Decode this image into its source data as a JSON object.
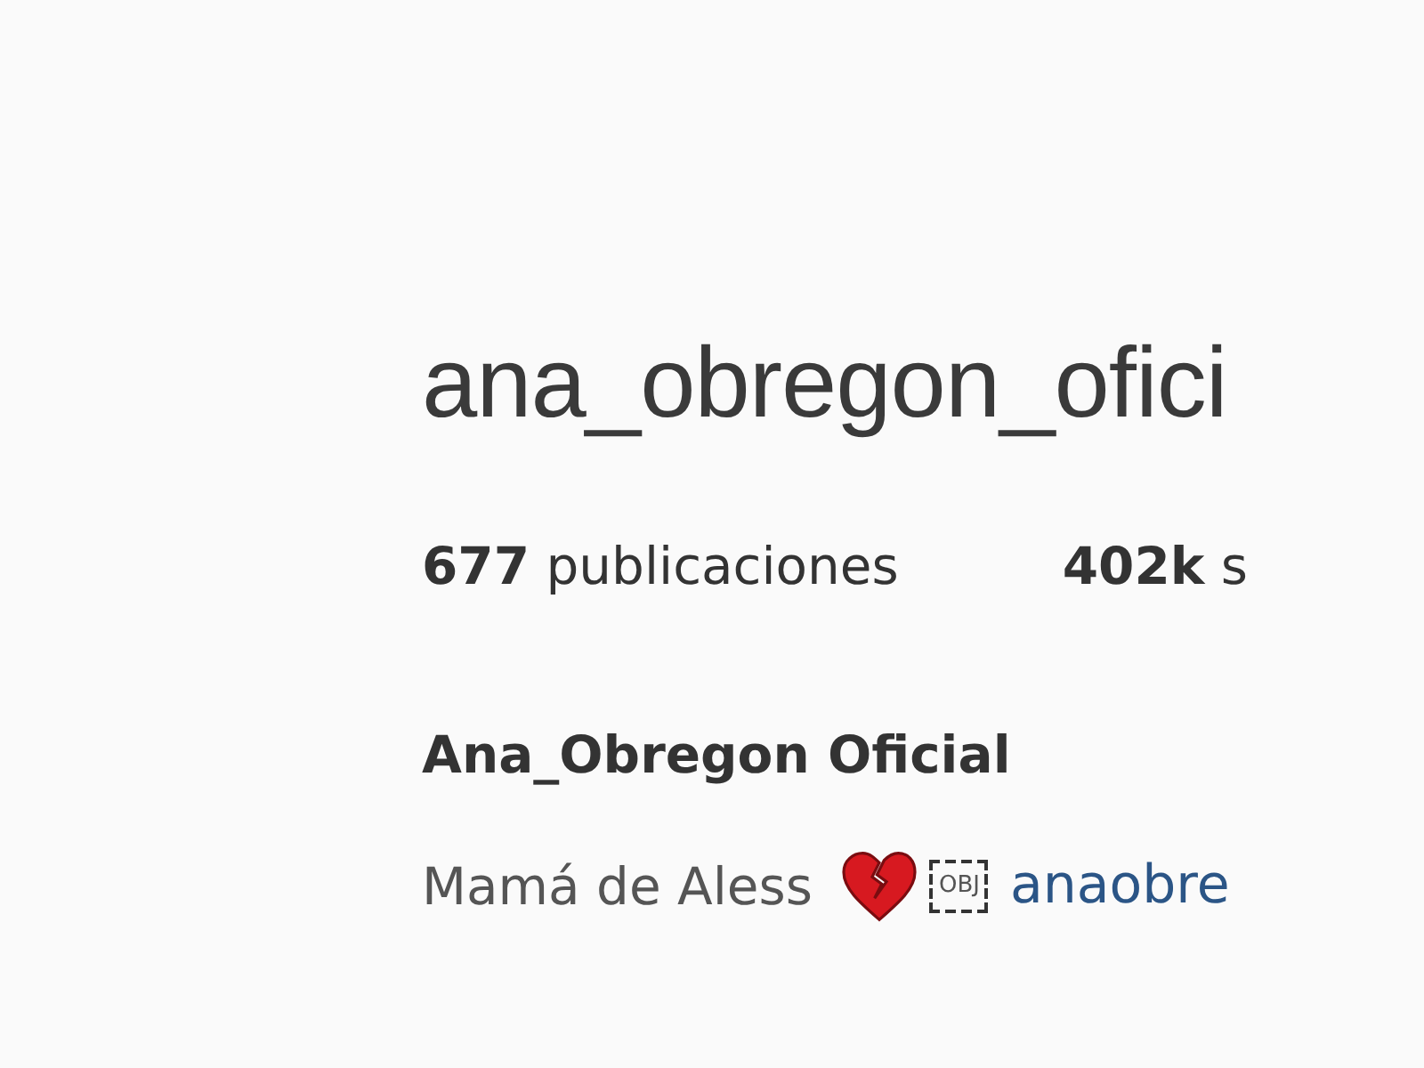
{
  "profile": {
    "username": "ana_obregon_ofici",
    "stats": [
      {
        "value": "677",
        "label": "publicaciones"
      },
      {
        "value": "402k",
        "label": "s"
      }
    ],
    "full_name": "Ana_Obregon Oficial",
    "bio": {
      "text": "Mamá de Aless",
      "placeholder_glyph": "OBJ",
      "link": "anaobre"
    }
  }
}
